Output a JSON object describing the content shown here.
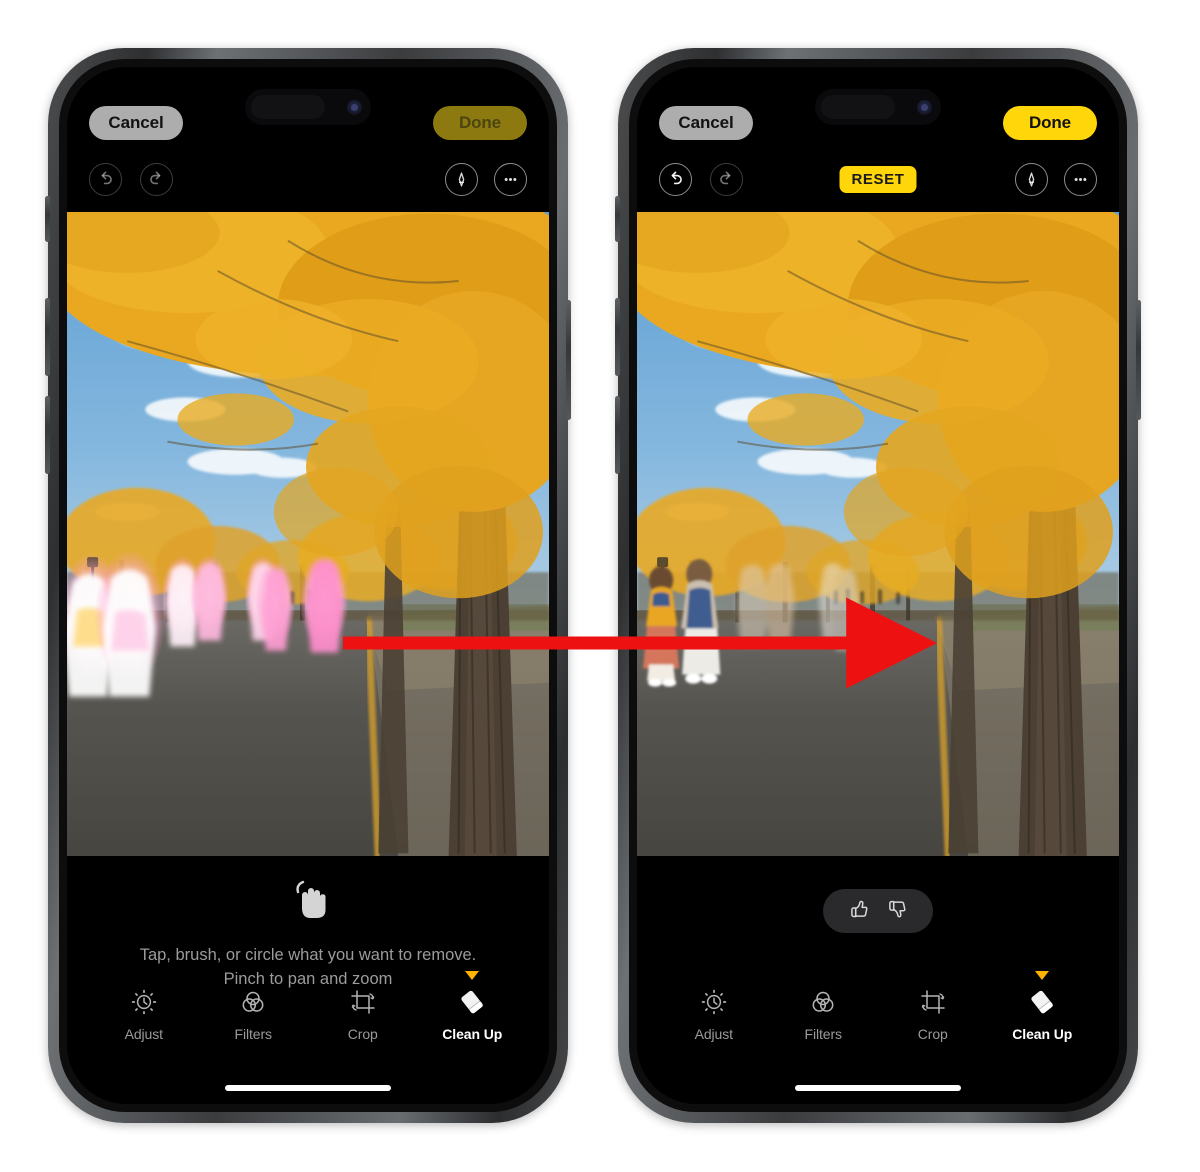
{
  "scene": {
    "description": "Side-by-side iPhone screenshots of the Apple Photos Clean Up editing tool, before and after removing people",
    "arrow_color": "#ee1111"
  },
  "phones": [
    {
      "id": "before",
      "topbar": {
        "cancel_label": "Cancel",
        "done_label": "Done",
        "done_state": "dimmed"
      },
      "toolrow": {
        "undo_icon": "undo-arrow-icon",
        "redo_icon": "redo-arrow-icon",
        "undo_enabled": false,
        "redo_enabled": false,
        "reset_label": "",
        "reset_visible": false,
        "markup_icon": "markup-pen-icon",
        "more_icon": "more-ellipsis-icon"
      },
      "photo": {
        "alt": "Autumn ginkgo tree avenue with yellow leaves, blue sky, people walking highlighted in pink and white glow",
        "highlight_count": 7,
        "highlight_colors": [
          "#ffffff",
          "#ffd9ea",
          "#ff9fd0",
          "#ffe9a0"
        ]
      },
      "hint": {
        "icon": "tap-hand-icon",
        "line1": "Tap, brush, or circle what you want to remove.",
        "line2": "Pinch to pan and zoom"
      },
      "feedback": {
        "visible": false,
        "thumbs_up_icon": "thumbs-up-icon",
        "thumbs_down_icon": "thumbs-down-icon"
      },
      "tabs": [
        {
          "label": "Adjust",
          "icon": "adjust-dial-icon",
          "active": false
        },
        {
          "label": "Filters",
          "icon": "filters-circles-icon",
          "active": false
        },
        {
          "label": "Crop",
          "icon": "crop-rotate-icon",
          "active": false
        },
        {
          "label": "Clean Up",
          "icon": "eraser-icon",
          "active": true
        }
      ]
    },
    {
      "id": "after",
      "topbar": {
        "cancel_label": "Cancel",
        "done_label": "Done",
        "done_state": "active"
      },
      "toolrow": {
        "undo_icon": "undo-arrow-icon",
        "redo_icon": "redo-arrow-icon",
        "undo_enabled": true,
        "redo_enabled": false,
        "reset_label": "RESET",
        "reset_visible": true,
        "markup_icon": "markup-pen-icon",
        "more_icon": "more-ellipsis-icon"
      },
      "photo": {
        "alt": "Same autumn ginkgo avenue with most background people removed by Clean Up, two women remaining in foreground",
        "highlight_count": 0,
        "highlight_colors": []
      },
      "hint": {
        "icon": "",
        "line1": "",
        "line2": ""
      },
      "feedback": {
        "visible": true,
        "thumbs_up_icon": "thumbs-up-icon",
        "thumbs_down_icon": "thumbs-down-icon"
      },
      "tabs": [
        {
          "label": "Adjust",
          "icon": "adjust-dial-icon",
          "active": false
        },
        {
          "label": "Filters",
          "icon": "filters-circles-icon",
          "active": false
        },
        {
          "label": "Crop",
          "icon": "crop-rotate-icon",
          "active": false
        },
        {
          "label": "Clean Up",
          "icon": "eraser-icon",
          "active": true
        }
      ]
    }
  ],
  "colors": {
    "accent_yellow": "#ffd60a",
    "dim_yellow": "#8c7a10",
    "cancel_gray": "#adadad",
    "screen_black": "#000000",
    "hint_gray": "#9b9b9b",
    "caret_amber": "#ffb300"
  }
}
